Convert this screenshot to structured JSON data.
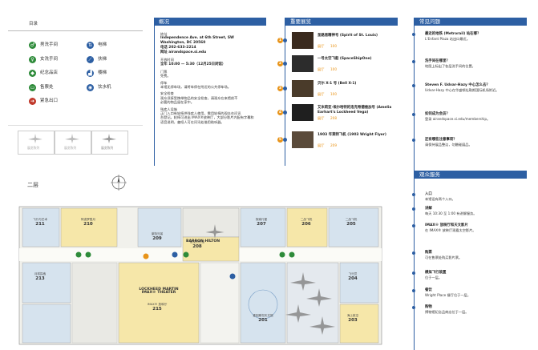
{
  "legend": {
    "title": "目录",
    "items": [
      {
        "label": "男洗手间",
        "icon": "mens-restroom-icon"
      },
      {
        "label": "电梯",
        "icon": "elevator-icon"
      },
      {
        "label": "女洗手间",
        "icon": "womens-restroom-icon"
      },
      {
        "label": "扶梯",
        "icon": "escalator-icon"
      },
      {
        "label": "纪念品店",
        "icon": "gift-shop-icon"
      },
      {
        "label": "楼梯",
        "icon": "stairs-icon"
      },
      {
        "label": "售票处",
        "icon": "ticket-icon"
      },
      {
        "label": "饮水机",
        "icon": "water-fountain-icon"
      },
      {
        "label": "紧急出口",
        "icon": "emergency-exit-icon"
      }
    ],
    "gallery_types": [
      "展览陈列",
      "展览陈列",
      "展览陈列"
    ]
  },
  "floor_label": "二层",
  "overview": {
    "title": "概况",
    "address_label": "地址",
    "address_lines": [
      "Independence Ave. at 6th Street, SW",
      "Washington, DC 20560",
      "电话 202-633-2214",
      "网址 airandspace.si.edu"
    ],
    "hours_label": "开放时间",
    "hours_line": "全年 10:00 — 5:30（12月25日闭馆）",
    "admission_label": "门票",
    "admission_line": "免费。",
    "parking_label": "停车",
    "parking_line": "本馆无停车场，请将车停在附近的公共停车场。",
    "security_label": "安全检查",
    "security_lines": [
      "观众须接受携带物品的安全检查，请观众在来馆前不",
      "必要的物品留在家中。"
    ],
    "accessibility_label": "残疾人设施",
    "accessibility_lines": [
      "正门入口有轮椅供残疾人使用，需用轮椅的观众在问讯",
      "台登记。轮椅可进出 IMAX®放映厅，大部分影片内配有字幕和",
      "语音说明，聋哑人可在问讯处借用助听器。"
    ]
  },
  "highlights": {
    "title": "重要展览",
    "items": [
      {
        "num": "1",
        "title": "圣路易精神号 (Spirit of St. Louis)",
        "sub": "展厅",
        "room": "100"
      },
      {
        "num": "2",
        "title": "一号太空飞船 (SpaceShipOne)",
        "sub": "展厅",
        "room": "100"
      },
      {
        "num": "3",
        "title": "贝尔 X-1 号 (Bell X-1)",
        "sub": "展厅",
        "room": "100"
      },
      {
        "num": "4",
        "title": "艾米莉亚·埃尔哈特的洛克希德维加号 (Amelia Earhart's Lockheed Vega)",
        "sub": "展厅",
        "room": "208"
      },
      {
        "num": "5",
        "title": "1903 年莱特飞机 (1903 Wright Flyer)",
        "sub": "展厅",
        "room": "209"
      }
    ]
  },
  "faq": {
    "title": "常见问题",
    "items": [
      {
        "q": "最近的地铁 (Metrorail) 站在哪？",
        "a": [
          "L'Enfant Plaza 站出口最近。"
        ]
      },
      {
        "q": "洗手间在哪里？",
        "a": [
          "地图上标出了各层洗手间的位置。"
        ]
      },
      {
        "q": "Steven F. Udvar-Hazy 中心怎么去？",
        "a": [
          "Udvar-Hazy 中心在华盛顿杜勒斯国际机场附近。"
        ]
      },
      {
        "q": "如何成为会员？",
        "a": [
          "登录 airandspace.si.edu/membership。"
        ]
      },
      {
        "q": "还有哪些注意事项？",
        "a": [
          "请保持展品整洁，勿触碰展品。"
        ]
      }
    ]
  },
  "services": {
    "title": "观众服务",
    "items": [
      {
        "label": "入口",
        "text": "本馆设有两个入口。"
      },
      {
        "label": "讲解",
        "text": "每天 10:30 至 1:00 有讲解服务。"
      },
      {
        "label": "IMAX® 放映厅和天文影片",
        "text": "在 IMAX® 放映厅观看太空影片。"
      },
      {
        "label": "购票",
        "text": "可在售票处购买影片票。"
      },
      {
        "label": "模拟飞行装置",
        "text": "位于一层。"
      },
      {
        "label": "餐饮",
        "text": "Wright Place 餐厅位于一层。"
      },
      {
        "label": "购物",
        "text": "博物馆纪念品商店位于一层。"
      }
    ]
  },
  "map": {
    "rooms": [
      {
        "num": "211",
        "name": "飞行与艺术"
      },
      {
        "num": "210",
        "name": "阿波罗登月"
      },
      {
        "num": "209",
        "name": "莱特兄弟"
      },
      {
        "num": "208",
        "name": "航空的先驱"
      },
      {
        "num": "207",
        "name": "探索行星"
      },
      {
        "num": "206",
        "name": "二战飞机"
      },
      {
        "num": "205",
        "name": "二战飞机"
      },
      {
        "num": "204",
        "name": "飞行员"
      },
      {
        "num": "203",
        "name": "海上航空"
      },
      {
        "num": "213",
        "name": "月球探索"
      },
      {
        "num": "215",
        "name": "IMAX® 放映厅"
      },
      {
        "num": "201",
        "name": "爱因斯坦天文馆"
      }
    ],
    "center_label": "BARRON HILTON",
    "imax_label": "LOCKHEED MARTIN IMAX® THEATER"
  },
  "colors": {
    "accent": "#2d5fa3",
    "highlight": "#e8941a"
  }
}
